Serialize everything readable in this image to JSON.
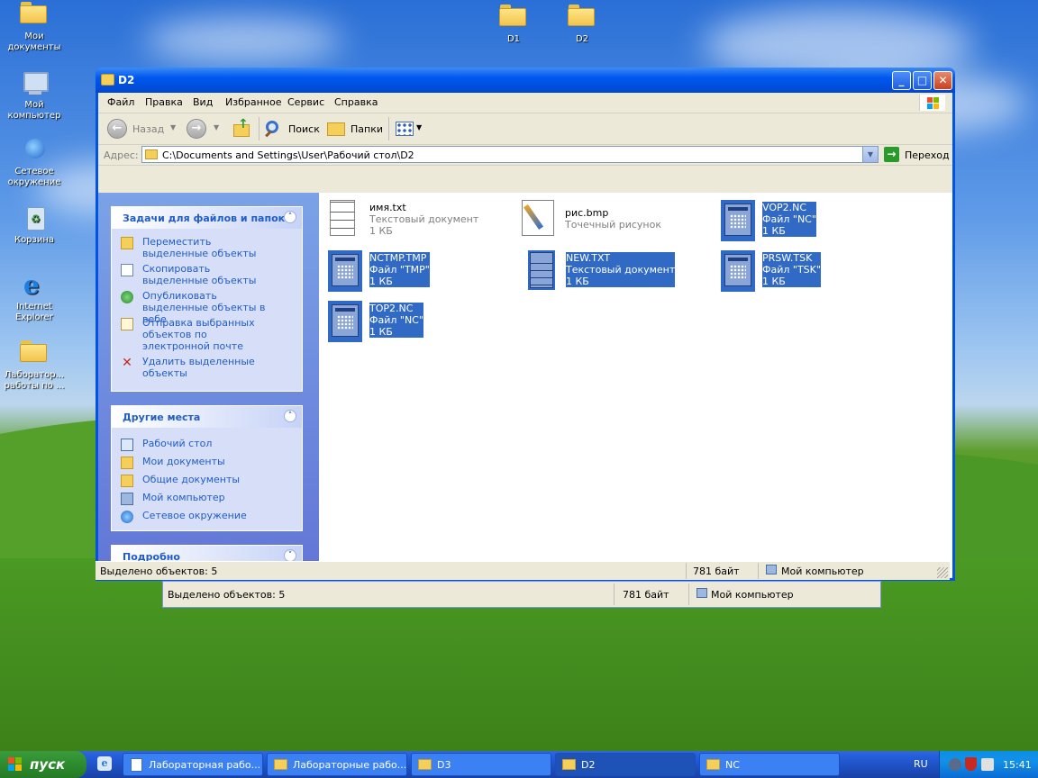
{
  "desktop": {
    "icons": [
      {
        "label": "Мои документы",
        "icon": "my-documents-icon"
      },
      {
        "label": "Мой компьютер",
        "icon": "my-computer-icon"
      },
      {
        "label": "Сетевое окружение",
        "icon": "network-places-icon"
      },
      {
        "label": "Корзина",
        "icon": "recycle-bin-icon"
      },
      {
        "label": "Internet Explorer",
        "icon": "internet-explorer-icon"
      },
      {
        "label": "Лаборатор... работы по ...",
        "icon": "folder-icon"
      },
      {
        "label": "D1",
        "icon": "folder-icon"
      },
      {
        "label": "D2",
        "icon": "folder-icon"
      }
    ]
  },
  "window": {
    "title": "D2",
    "menu": [
      "Файл",
      "Правка",
      "Вид",
      "Избранное",
      "Сервис",
      "Справка"
    ],
    "toolbar": {
      "back": "Назад",
      "search": "Поиск",
      "folders": "Папки"
    },
    "address": {
      "label": "Адрес:",
      "value": "C:\\Documents and Settings\\User\\Рабочий стол\\D2",
      "go": "Переход"
    },
    "tasks_panel": {
      "title": "Задачи для файлов и папок",
      "items": [
        {
          "label": "Переместить выделенные объекты",
          "icon": "move-icon"
        },
        {
          "label": "Скопировать выделенные объекты",
          "icon": "copy-icon"
        },
        {
          "label": "Опубликовать выделенные объекты в вебе",
          "icon": "publish-web-icon"
        },
        {
          "label": "Отправка выбранных объектов по электронной почте",
          "icon": "email-icon"
        },
        {
          "label": "Удалить выделенные объекты",
          "icon": "delete-icon"
        }
      ]
    },
    "places_panel": {
      "title": "Другие места",
      "items": [
        {
          "label": "Рабочий стол",
          "icon": "desktop-icon"
        },
        {
          "label": "Мои документы",
          "icon": "my-documents-icon"
        },
        {
          "label": "Общие документы",
          "icon": "folder-icon"
        },
        {
          "label": "Мой компьютер",
          "icon": "my-computer-icon"
        },
        {
          "label": "Сетевое окружение",
          "icon": "network-places-icon"
        }
      ]
    },
    "details_panel": {
      "title": "Подробно"
    },
    "files": [
      {
        "name": "имя.txt",
        "type": "Текстовый документ",
        "size": "1 КБ",
        "selected": false,
        "icon": "text-file-icon"
      },
      {
        "name": "рис.bmp",
        "type": "Точечный рисунок",
        "size": "",
        "selected": false,
        "icon": "bitmap-file-icon"
      },
      {
        "name": "VOP2.NC",
        "type": "Файл \"NC\"",
        "size": "1 КБ",
        "selected": true,
        "icon": "program-file-icon"
      },
      {
        "name": "NCTMP.TMP",
        "type": "Файл \"TMP\"",
        "size": "1 КБ",
        "selected": true,
        "icon": "program-file-icon"
      },
      {
        "name": "NEW.TXT",
        "type": "Текстовый документ",
        "size": "1 КБ",
        "selected": true,
        "icon": "text-file-icon"
      },
      {
        "name": "PRSW.TSK",
        "type": "Файл \"TSK\"",
        "size": "1 КБ",
        "selected": true,
        "icon": "program-file-icon"
      },
      {
        "name": "TOP2.NC",
        "type": "Файл \"NC\"",
        "size": "1 КБ",
        "selected": true,
        "icon": "program-file-icon"
      }
    ],
    "status": {
      "selected": "Выделено объектов: 5",
      "size": "781 байт",
      "location": "Мой компьютер"
    }
  },
  "background_window_status": {
    "selected": "Выделено объектов: 5",
    "size": "781 байт",
    "location": "Мой компьютер"
  },
  "taskbar": {
    "start": "пуск",
    "tasks": [
      {
        "label": "Лабораторная рабо...",
        "icon": "document-icon",
        "active": false
      },
      {
        "label": "Лабораторные рабо...",
        "icon": "folder-icon",
        "active": false
      },
      {
        "label": "D3",
        "icon": "folder-icon",
        "active": false
      },
      {
        "label": "D2",
        "icon": "folder-icon",
        "active": true
      },
      {
        "label": "NC",
        "icon": "folder-icon",
        "active": false
      }
    ],
    "language": "RU",
    "clock": "15:41"
  }
}
